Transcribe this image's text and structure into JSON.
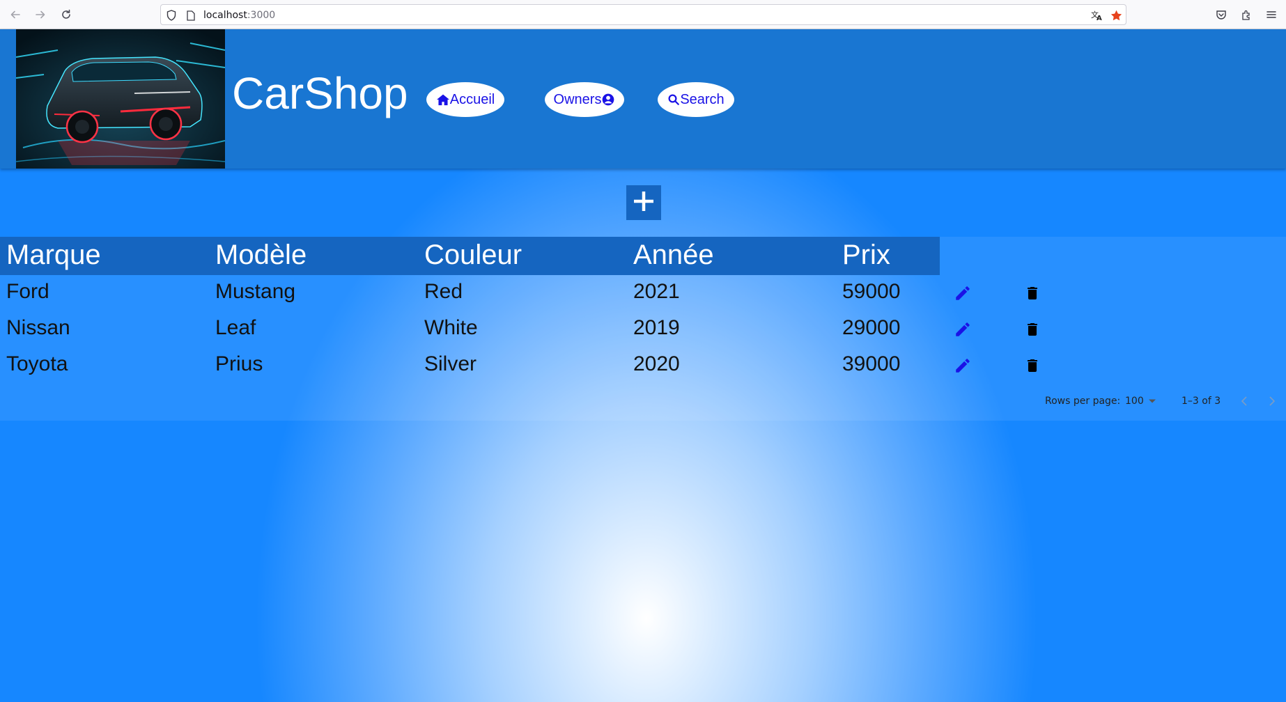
{
  "browser": {
    "url_host": "localhost",
    "url_port": ":3000"
  },
  "header": {
    "title": "CarShop",
    "nav": {
      "home_label": "Accueil",
      "owners_label": "Owners",
      "search_label": "Search"
    }
  },
  "table": {
    "columns": [
      "Marque",
      "Modèle",
      "Couleur",
      "Année",
      "Prix"
    ],
    "rows": [
      {
        "brand": "Ford",
        "model": "Mustang",
        "color": "Red",
        "year": "2021",
        "price": "59000"
      },
      {
        "brand": "Nissan",
        "model": "Leaf",
        "color": "White",
        "year": "2019",
        "price": "29000"
      },
      {
        "brand": "Toyota",
        "model": "Prius",
        "color": "Silver",
        "year": "2020",
        "price": "39000"
      }
    ]
  },
  "pagination": {
    "rows_per_page_label": "Rows per page:",
    "rows_per_page_value": "100",
    "range_label": "1–3 of 3"
  },
  "colors": {
    "header_bar": "#1976d2",
    "table_header": "#1565c0",
    "nav_text": "#1a12e6",
    "edit_icon": "#1a12e6",
    "delete_icon": "#000000"
  },
  "icons": {
    "add": "plus-icon",
    "edit": "pencil-icon",
    "delete": "trash-icon",
    "home": "home-icon",
    "owners": "account-circle-icon",
    "search": "search-icon"
  }
}
